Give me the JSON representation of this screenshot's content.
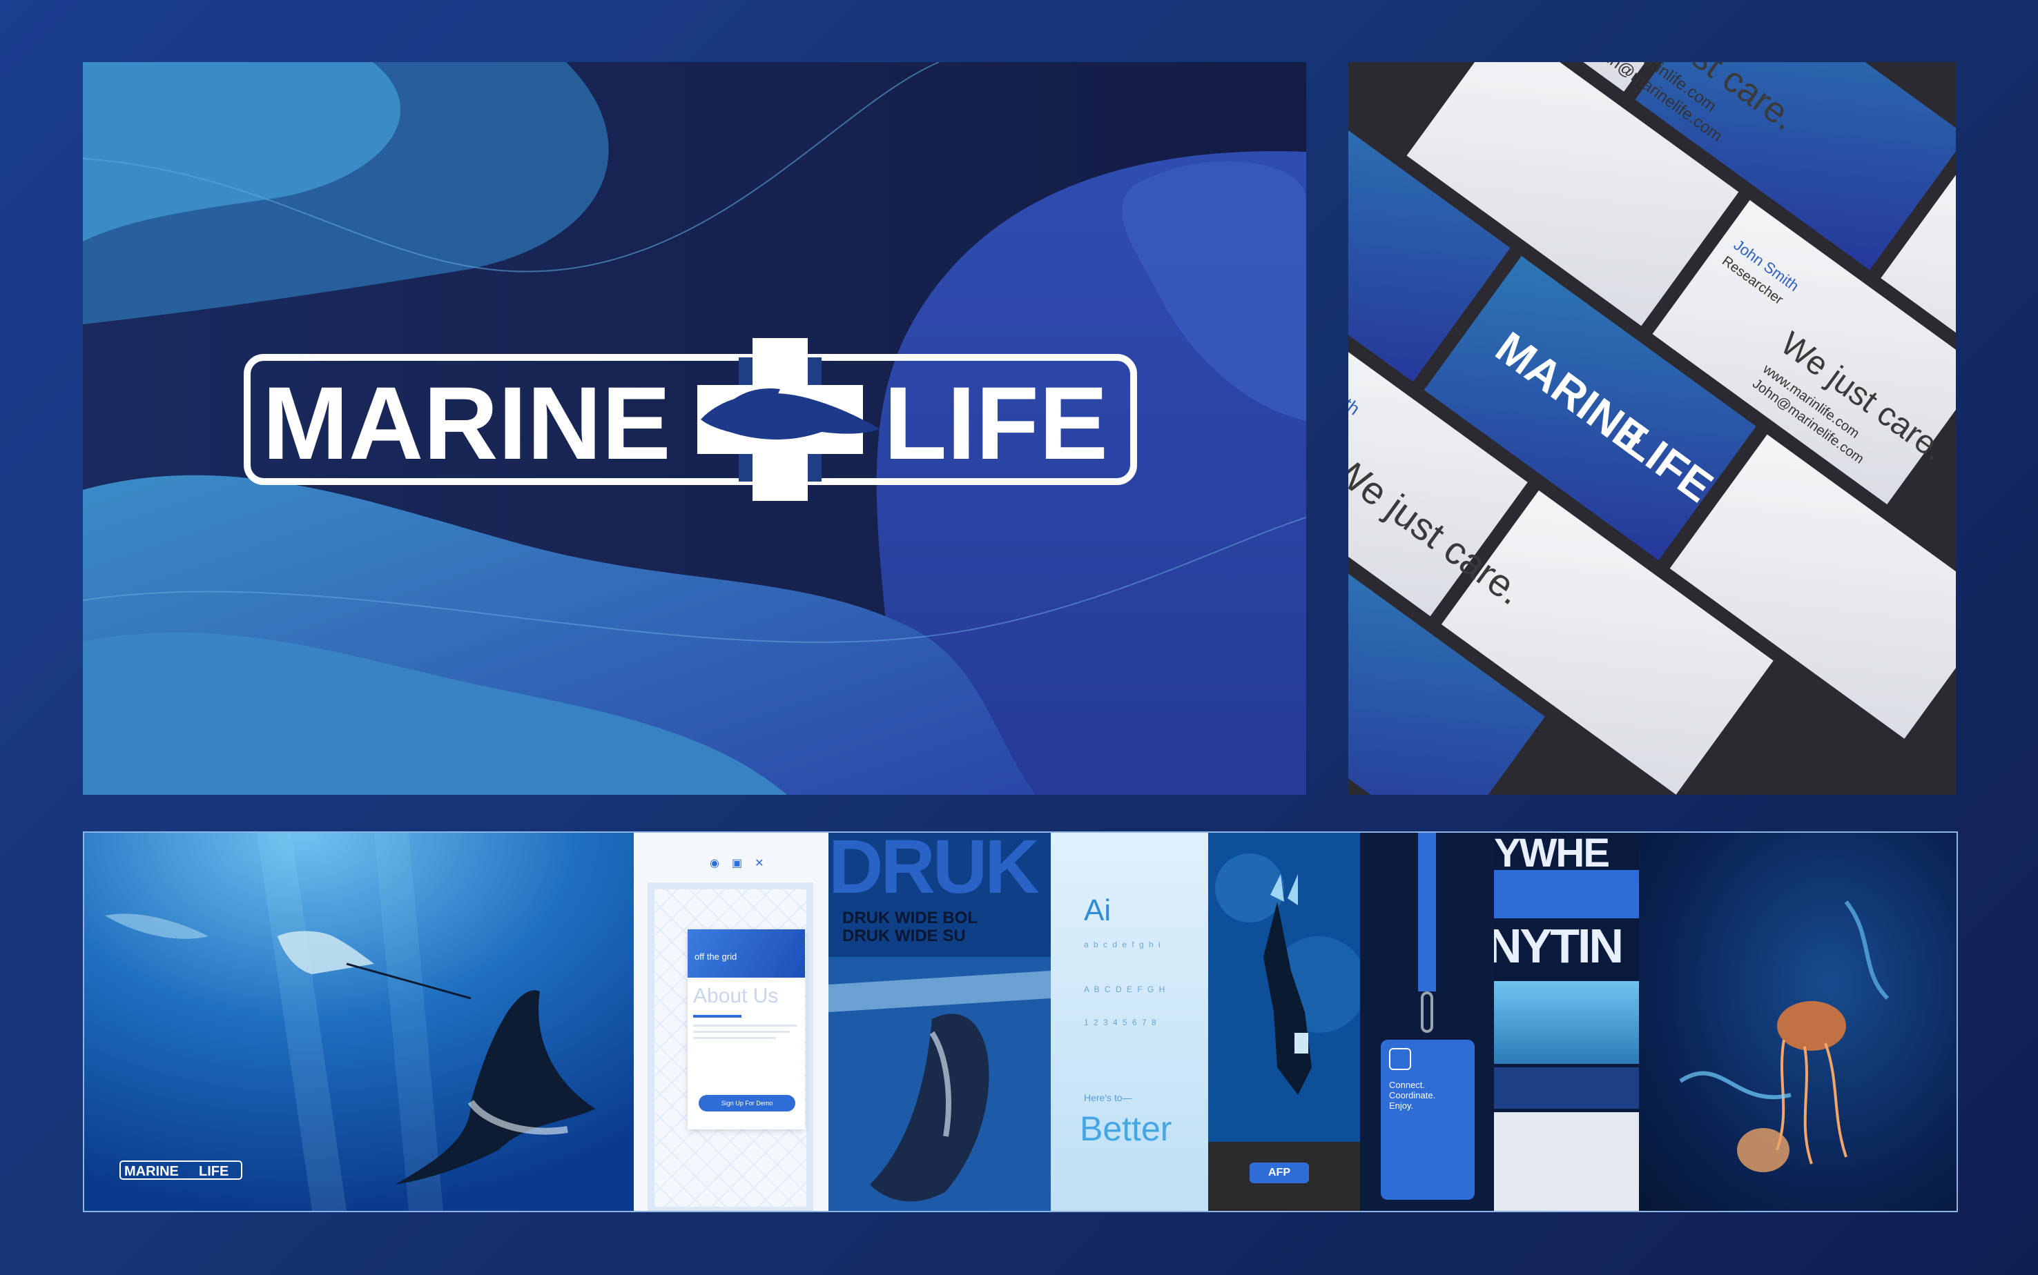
{
  "brand": {
    "name_left": "MARINE",
    "name_right": "LIFE",
    "colors": {
      "navy": "#141f4d",
      "ocean_blue": "#2b7ab8",
      "royal_blue": "#2a3d9f",
      "white": "#ffffff"
    }
  },
  "business_card": {
    "tagline": "We just care.",
    "person_name": "John Smith",
    "person_title": "Researcher",
    "website": "www.marinlife.com",
    "email": "John@marinelife.com"
  },
  "moodboard": {
    "ui_heading": "About Us",
    "ui_subtitle": "off the grid",
    "ui_button": "Sign Up For Demo",
    "type_heading": "DRUK",
    "type_line_1": "DRUK WIDE BOL",
    "type_line_2": "DRUK WIDE SU",
    "type_sample_ai": "Ai",
    "type_sample_alphabet_1": "a b c d e f g h i",
    "type_sample_alphabet_2": "A B C D E F G H",
    "type_sample_numbers": "1 2 3 4 5 6 7 8",
    "type_caption": "Here's to—",
    "type_better": "Better",
    "tag_label": "AFP",
    "badge_text_1": "Connect.",
    "badge_text_2": "Coordinate.",
    "badge_text_3": "Enjoy.",
    "poster_top": "YWHE",
    "poster_bottom": "NYTIN",
    "icons": [
      "eye-icon",
      "lock-icon",
      "close-icon"
    ]
  }
}
